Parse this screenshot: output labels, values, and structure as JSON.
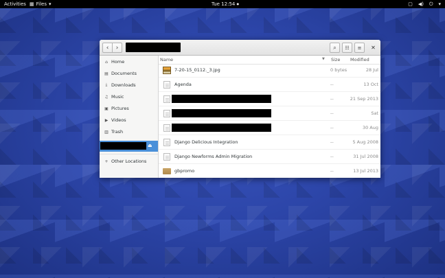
{
  "topbar": {
    "activities": "Activities",
    "app_menu": "Files",
    "app_menu_arrow": "▾",
    "app_icon": "files-app-icon",
    "clock": "Tue 12:54",
    "clock_dot": "●",
    "tray_icons": [
      "window-icon",
      "volume-icon",
      "power-icon"
    ],
    "tray_arrow": "▾"
  },
  "window": {
    "nav": {
      "back": "‹",
      "forward": "›"
    },
    "toolbar": {
      "search": "⌕",
      "view": "☷",
      "menu": "≡",
      "close": "✕"
    }
  },
  "sidebar": {
    "items": [
      {
        "label": "Home",
        "icon": "⌂"
      },
      {
        "label": "Documents",
        "icon": "▤"
      },
      {
        "label": "Downloads",
        "icon": "⤓"
      },
      {
        "label": "Music",
        "icon": "♫"
      },
      {
        "label": "Pictures",
        "icon": "▣"
      },
      {
        "label": "Videos",
        "icon": "▶"
      },
      {
        "label": "Trash",
        "icon": "▥"
      }
    ],
    "eject": "⏏",
    "other_locations": {
      "label": "Other Locations",
      "icon": "+"
    }
  },
  "filelist": {
    "columns": {
      "name": "Name",
      "sort_arrow": "▼",
      "size": "Size",
      "modified": "Modified"
    },
    "rows": [
      {
        "name": "7-20-15_0112._3.jpg",
        "size": "0 bytes",
        "modified": "28 Jul",
        "type": "image"
      },
      {
        "name": "Agenda",
        "size": "--",
        "modified": "13 Oct",
        "type": "doc"
      },
      {
        "name": "",
        "size": "--",
        "modified": "21 Sep 2013",
        "type": "doc-redacted"
      },
      {
        "name": "",
        "size": "--",
        "modified": "Sat",
        "type": "doc-redacted"
      },
      {
        "name": "",
        "size": "--",
        "modified": "30 Aug",
        "type": "doc-redacted"
      },
      {
        "name": "Django Delicious Integration",
        "size": "--",
        "modified": "5 Aug 2008",
        "type": "doc"
      },
      {
        "name": "Django Newforms Admin Migration",
        "size": "--",
        "modified": "31 Jul 2008",
        "type": "doc"
      },
      {
        "name": "gbpromo",
        "size": "--",
        "modified": "13 Jul 2013",
        "type": "folder"
      }
    ]
  },
  "colors": {
    "accent": "#4a90d9",
    "topbar": "#000000",
    "desktop": "#2c45a8"
  }
}
